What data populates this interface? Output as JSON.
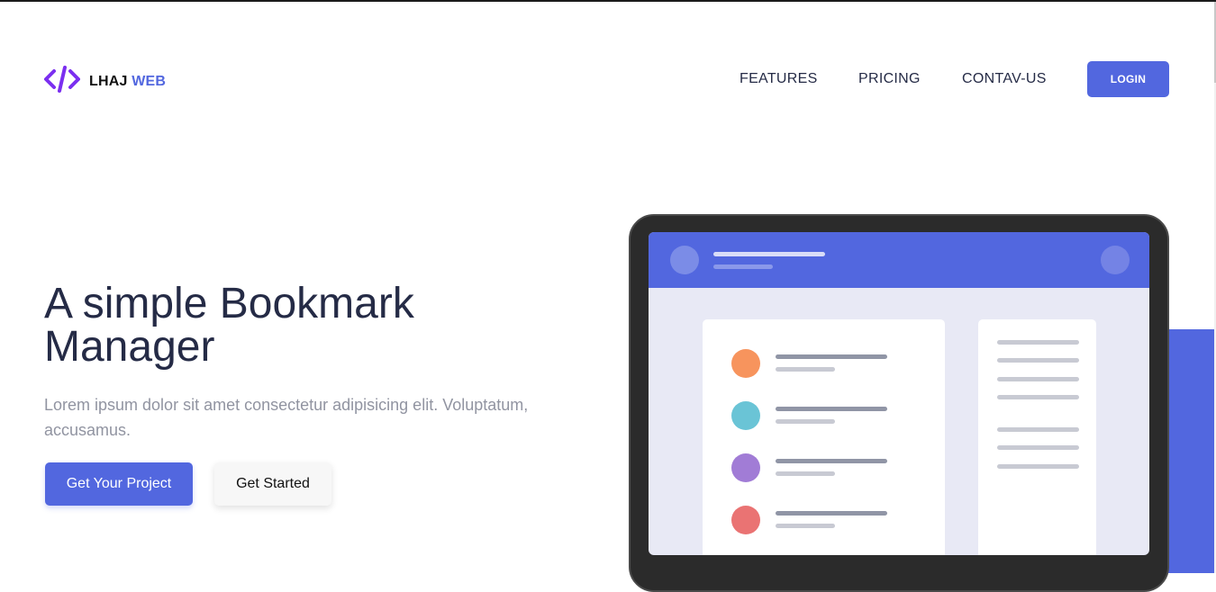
{
  "brand": {
    "name": "LHAJ",
    "accent": "WEB",
    "icon": "code-icon",
    "color": "#5267df",
    "icon_color": "#7b2ff0"
  },
  "nav": {
    "items": [
      "FEATURES",
      "PRICING",
      "CONTAV-US"
    ],
    "login_label": "LOGIN"
  },
  "hero": {
    "title": "A simple Bookmark Manager",
    "description": "Lorem ipsum dolor sit amet consectetur adipisicing elit. Voluptatum, accusamus.",
    "primary_cta": "Get Your Project",
    "secondary_cta": "Get Started"
  },
  "illustration": {
    "kind": "tablet-mockup",
    "list_dot_colors": [
      "#f7945d",
      "#6ac4d6",
      "#a17cd6",
      "#ea7373"
    ]
  },
  "colors": {
    "primary": "#5267df",
    "heading": "#252b46",
    "muted": "#9194a1"
  }
}
